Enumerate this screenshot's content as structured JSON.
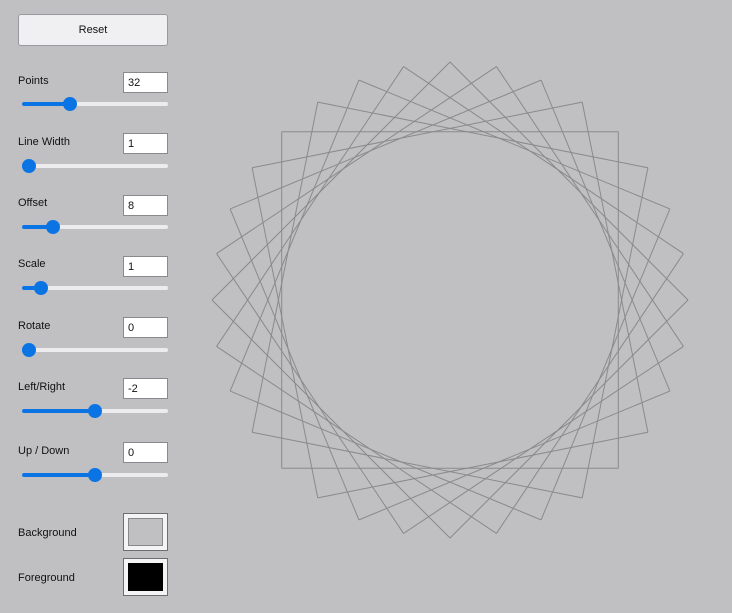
{
  "reset_label": "Reset",
  "controls": [
    {
      "key": "points",
      "label": "Points",
      "value": "32",
      "fraction": 0.33
    },
    {
      "key": "line-width",
      "label": "Line Width",
      "value": "1",
      "fraction": 0.04
    },
    {
      "key": "offset",
      "label": "Offset",
      "value": "8",
      "fraction": 0.21
    },
    {
      "key": "scale",
      "label": "Scale",
      "value": "1",
      "fraction": 0.13
    },
    {
      "key": "rotate",
      "label": "Rotate",
      "value": "0",
      "fraction": 0.04
    },
    {
      "key": "left-right",
      "label": "Left/Right",
      "value": "-2",
      "fraction": 0.5
    },
    {
      "key": "up-down",
      "label": "Up / Down",
      "value": "0",
      "fraction": 0.5
    }
  ],
  "colors": {
    "background_label": "Background",
    "background_value": "#c0c0c2",
    "foreground_label": "Foreground",
    "foreground_value": "#000000",
    "slider_accent": "#0b74e5",
    "track": "#ececee",
    "stroke": "#8a8a8c"
  }
}
